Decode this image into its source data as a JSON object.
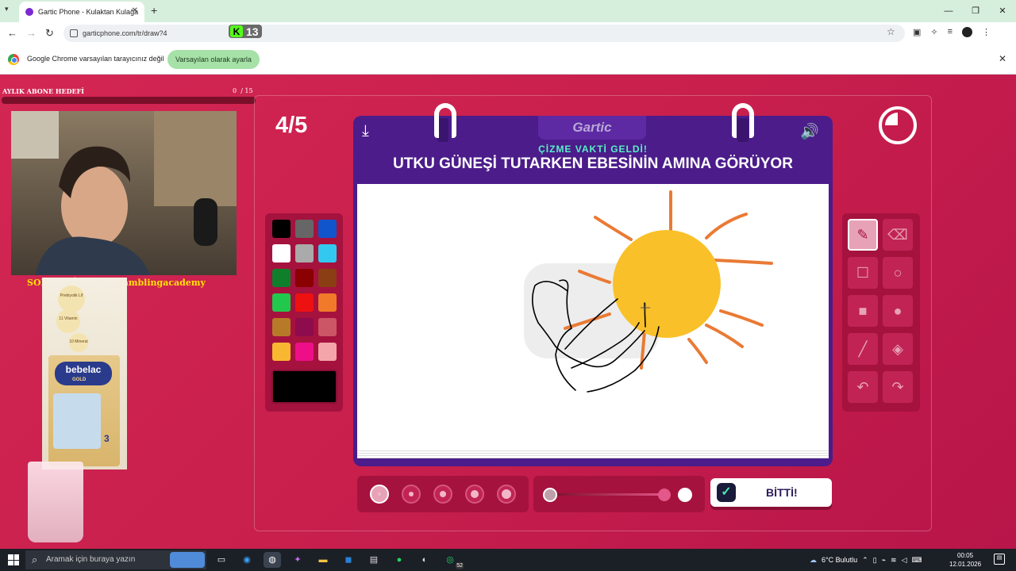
{
  "browser": {
    "tab_title": "Gartic Phone - Kulaktan Kulağa",
    "tab_close": "✕",
    "new_tab": "+",
    "url": "garticphone.com/tr/draw?4",
    "kick_count": "13",
    "kick_letter": "K",
    "info_text": "Google Chrome varsayılan tarayıcınız değil",
    "set_default": "Varsayılan olarak ayarla",
    "info_close": "✕",
    "win_min": "—",
    "win_max": "❐",
    "win_close": "✕"
  },
  "overlay": {
    "goal_label": "AYLIK ABONE HEDEFİ",
    "goal_current": "0",
    "goal_sep": "/ 15",
    "sponsor_text": "SOB OG: İ! ayıtkalgamblingacademy",
    "product_brand": "bebelac",
    "product_sub": "GOLD",
    "product_stage": "3",
    "product_badges": [
      "Prebiyotik Lif",
      "11 Vitamin",
      "10 Mineral"
    ]
  },
  "game": {
    "round": "4/5",
    "logo": "Gartic",
    "subtitle": "ÇİZME VAKTİ GELDİ!",
    "prompt": "UTKU GÜNEŞİ TUTARKEN EBESİNİN AMINA GÖRÜYOR",
    "done_label": "BİTTİ!",
    "timer_remaining_fraction": 0.75,
    "palette": [
      "#000000",
      "#666666",
      "#1155cc",
      "#ffffff",
      "#aaaaaa",
      "#33c8f0",
      "#0f7f2c",
      "#8b0000",
      "#8b3d13",
      "#22c84b",
      "#ee1111",
      "#f07a2a",
      "#b77a29",
      "#8e0b4d",
      "#cc5566",
      "#f7b731",
      "#ee0f88",
      "#f4a5a9"
    ],
    "selected_color": "#000000",
    "brush_sizes": [
      1,
      2,
      3,
      4,
      5
    ],
    "selected_brush_size": 1,
    "opacity": 1.0,
    "tools": [
      "pencil",
      "eraser",
      "rectangle-outline",
      "ellipse-outline",
      "rectangle-fill",
      "ellipse-fill",
      "line",
      "bucket",
      "undo",
      "redo"
    ],
    "selected_tool": "pencil"
  },
  "taskbar": {
    "search_placeholder": "Aramak için buraya yazın",
    "weather": "6°C Bulutlu",
    "time": "00:05",
    "date": "12.01.2026",
    "whatsapp_badge": "52"
  }
}
